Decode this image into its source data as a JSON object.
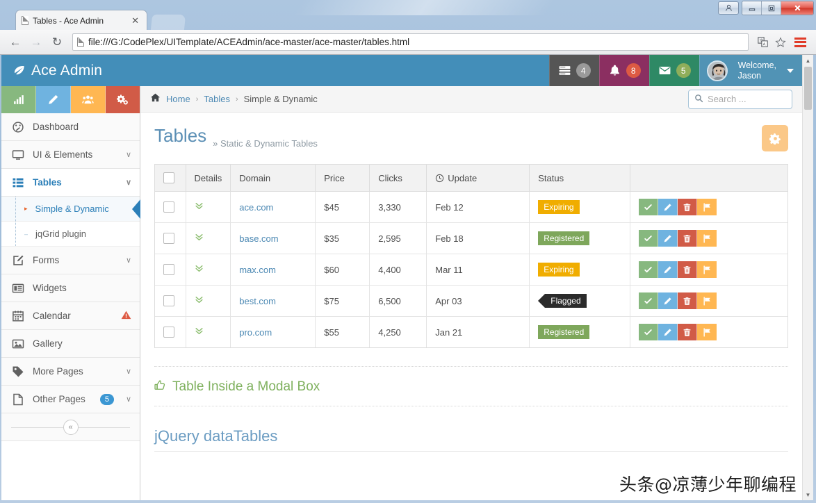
{
  "browser": {
    "tab_title": "Tables - Ace Admin",
    "tab_close": "✕",
    "url": "file:///G:/CodePlex/UITemplate/ACEAdmin/ace-master/ace-master/tables.html",
    "back": "←",
    "forward": "→",
    "reload": "↻",
    "window_user": "☰",
    "window_min": "—",
    "window_max": "❐",
    "window_close": "✕"
  },
  "navbar": {
    "brand": "Ace Admin",
    "tasks_count": "4",
    "notifications_count": "8",
    "messages_count": "5",
    "welcome": "Welcome,\nJason"
  },
  "sidebar": {
    "shortcuts": [
      "chart-icon",
      "pencil-icon",
      "users-icon",
      "cogs-icon"
    ],
    "items": [
      {
        "label": "Dashboard",
        "icon": "dashboard-icon",
        "chevron": "",
        "badge": "",
        "warn": false
      },
      {
        "label": "UI & Elements",
        "icon": "monitor-icon",
        "chevron": "∨",
        "badge": "",
        "warn": false
      },
      {
        "label": "Tables",
        "icon": "list-icon",
        "chevron": "∨",
        "badge": "",
        "warn": false
      },
      {
        "label": "Forms",
        "icon": "edit-icon",
        "chevron": "∨",
        "badge": "",
        "warn": false
      },
      {
        "label": "Widgets",
        "icon": "widgets-icon",
        "chevron": "",
        "badge": "",
        "warn": false
      },
      {
        "label": "Calendar",
        "icon": "calendar-icon",
        "chevron": "",
        "badge": "",
        "warn": true
      },
      {
        "label": "Gallery",
        "icon": "gallery-icon",
        "chevron": "",
        "badge": "",
        "warn": false
      },
      {
        "label": "More Pages",
        "icon": "tag-icon",
        "chevron": "∨",
        "badge": "",
        "warn": false
      },
      {
        "label": "Other Pages",
        "icon": "file-icon",
        "chevron": "∨",
        "badge": "5",
        "warn": false
      }
    ],
    "submenu": [
      {
        "label": "Simple & Dynamic",
        "active": true
      },
      {
        "label": "jqGrid plugin",
        "active": false
      }
    ],
    "collapse_icon": "«"
  },
  "breadcrumb": {
    "home": "Home",
    "tables": "Tables",
    "current": "Simple & Dynamic",
    "sep": "›"
  },
  "search": {
    "placeholder": "Search ...",
    "value": "",
    "icon": "search-icon"
  },
  "page": {
    "title": "Tables",
    "subtitle": "» Static & Dynamic Tables",
    "settings_icon": "gear-icon"
  },
  "table": {
    "headers": [
      "",
      "Details",
      "Domain",
      "Price",
      "Clicks",
      "Update",
      "Status",
      ""
    ],
    "update_icon": "clock-icon",
    "rows": [
      {
        "domain": "ace.com",
        "price": "$45",
        "clicks": "3,330",
        "update": "Feb 12",
        "status": "Expiring",
        "status_type": "expiring"
      },
      {
        "domain": "base.com",
        "price": "$35",
        "clicks": "2,595",
        "update": "Feb 18",
        "status": "Registered",
        "status_type": "registered"
      },
      {
        "domain": "max.com",
        "price": "$60",
        "clicks": "4,400",
        "update": "Mar 11",
        "status": "Expiring",
        "status_type": "expiring"
      },
      {
        "domain": "best.com",
        "price": "$75",
        "clicks": "6,500",
        "update": "Apr 03",
        "status": "Flagged",
        "status_type": "flagged"
      },
      {
        "domain": "pro.com",
        "price": "$55",
        "clicks": "4,250",
        "update": "Jan 21",
        "status": "Registered",
        "status_type": "registered"
      }
    ],
    "actions": [
      "approve-icon",
      "edit-icon",
      "delete-icon",
      "flag-icon"
    ]
  },
  "sections": {
    "modal_heading": "Table Inside a Modal Box",
    "modal_icon": "thumbs-up-icon",
    "datatables_heading": "jQuery dataTables"
  },
  "watermark": "头条@凉薄少年聊编程",
  "colors": {
    "navbar": "#438eb9",
    "accent_blue": "#4b88b3",
    "green": "#87b87f",
    "orange": "#ffb752",
    "red": "#d15b47",
    "badge_expiring": "#f0ad00",
    "badge_registered": "#7ea75b",
    "badge_flagged": "#2b2b2b"
  }
}
